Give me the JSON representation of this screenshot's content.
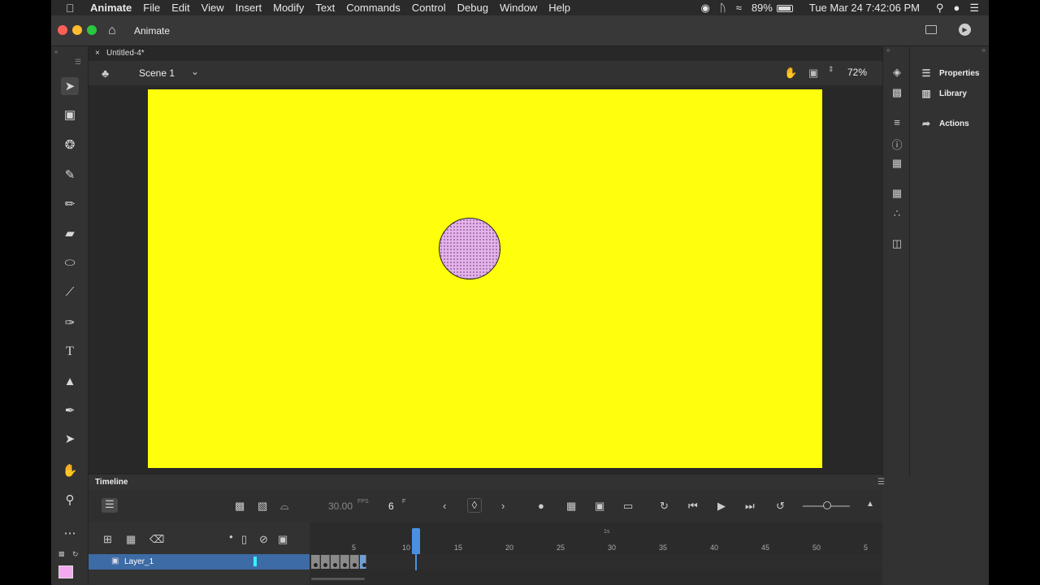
{
  "menubar": {
    "app": "Animate",
    "menus": [
      "File",
      "Edit",
      "View",
      "Insert",
      "Modify",
      "Text",
      "Commands",
      "Control",
      "Debug",
      "Window",
      "Help"
    ],
    "battery": "89%",
    "clock": "Tue Mar 24  7:42:06 PM"
  },
  "titlebar": {
    "title": "Animate"
  },
  "document": {
    "tab": "Untitled-4*",
    "scene": "Scene 1",
    "zoom": "72%"
  },
  "stage": {
    "background": "#ffff0b",
    "circle_fill": "#e4b3e8"
  },
  "panels": {
    "properties": "Properties",
    "library": "Library",
    "actions": "Actions"
  },
  "timeline": {
    "title": "Timeline",
    "fps": "30.00",
    "fps_unit": "FPS",
    "frame": "6",
    "frame_unit": "F",
    "seconds_label": "1s",
    "ticks": [
      "5",
      "10",
      "15",
      "20",
      "25",
      "30",
      "35",
      "40",
      "45",
      "50",
      "5"
    ],
    "layer": "Layer_1"
  }
}
